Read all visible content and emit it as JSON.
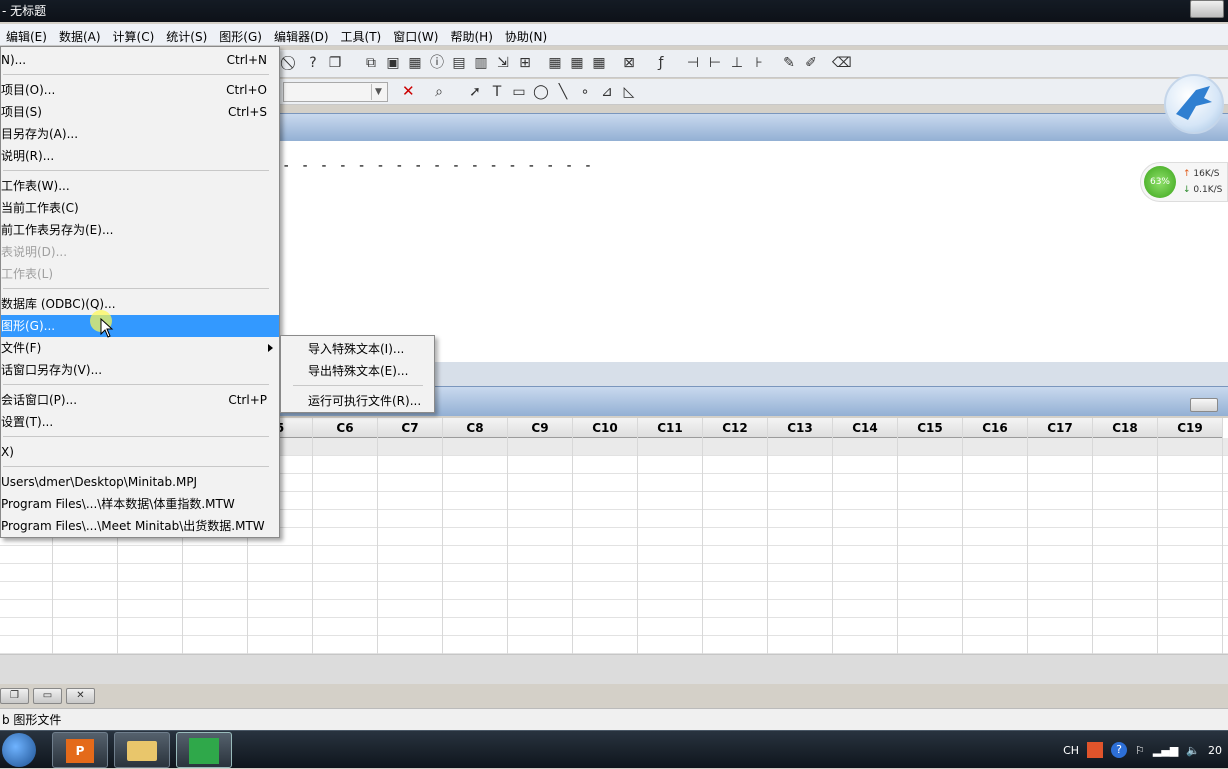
{
  "window": {
    "title": "- 无标题"
  },
  "menubar": [
    "编辑(E)",
    "数据(A)",
    "计算(C)",
    "统计(S)",
    "图形(G)",
    "编辑器(D)",
    "工具(T)",
    "窗口(W)",
    "帮助(H)",
    "协助(N)"
  ],
  "file_menu": {
    "items": [
      {
        "label": "N)...",
        "shortcut": "Ctrl+N"
      },
      {
        "label": "项目(O)...",
        "shortcut": "Ctrl+O"
      },
      {
        "label": "项目(S)",
        "shortcut": "Ctrl+S"
      },
      {
        "label": "目另存为(A)...",
        "shortcut": ""
      },
      {
        "label": "说明(R)...",
        "shortcut": ""
      },
      {
        "label": "工作表(W)...",
        "shortcut": ""
      },
      {
        "label": "当前工作表(C)",
        "shortcut": ""
      },
      {
        "label": "前工作表另存为(E)...",
        "shortcut": ""
      },
      {
        "label": "表说明(D)...",
        "shortcut": ""
      },
      {
        "label": "工作表(L)",
        "shortcut": ""
      },
      {
        "label": "数据库 (ODBC)(Q)...",
        "shortcut": ""
      },
      {
        "label": "图形(G)...",
        "shortcut": ""
      },
      {
        "label": "文件(F)",
        "shortcut": ""
      },
      {
        "label": "话窗口另存为(V)...",
        "shortcut": ""
      },
      {
        "label": "会话窗口(P)...",
        "shortcut": "Ctrl+P"
      },
      {
        "label": "设置(T)...",
        "shortcut": ""
      },
      {
        "label": "X)",
        "shortcut": ""
      },
      {
        "label": "Users\\dmer\\Desktop\\Minitab.MPJ",
        "shortcut": ""
      },
      {
        "label": "Program Files\\...\\样本数据\\体重指数.MTW",
        "shortcut": ""
      },
      {
        "label": "Program Files\\...\\Meet Minitab\\出货数据.MTW",
        "shortcut": ""
      }
    ]
  },
  "submenu": [
    "导入特殊文本(I)...",
    "导出特殊文本(E)...",
    "运行可执行文件(R)..."
  ],
  "session": {
    "dashes": "- - - - - - - - - - - - - - - - -"
  },
  "worksheet": {
    "columns": [
      "5",
      "C6",
      "C7",
      "C8",
      "C9",
      "C10",
      "C11",
      "C12",
      "C13",
      "C14",
      "C15",
      "C16",
      "C17",
      "C18",
      "C19"
    ]
  },
  "status": {
    "text": "b 图形文件"
  },
  "network": {
    "percent": "63%",
    "up": "16K/S",
    "down": "0.1K/S"
  },
  "tray": {
    "lang": "CH",
    "clock": "20"
  }
}
